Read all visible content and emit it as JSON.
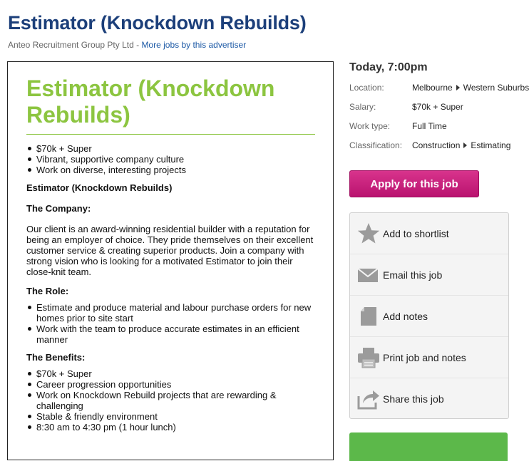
{
  "header": {
    "title": "Estimator (Knockdown Rebuilds)",
    "company": "Anteo Recruitment Group Pty Ltd",
    "separator": " - ",
    "more_jobs_link": "More jobs by this advertiser"
  },
  "ad": {
    "title": "Estimator (Knockdown Rebuilds)",
    "highlights": [
      "$70k + Super",
      "Vibrant, supportive company culture",
      "Work on diverse, interesting projects"
    ],
    "subtitle": "Estimator (Knockdown Rebuilds)",
    "company_heading": "The Company:",
    "company_text": "Our client is an award-winning residential builder with a reputation for being an employer of choice. They pride themselves on their excellent customer service & creating superior products. Join a company with strong vision who is looking for a motivated Estimator to join their close-knit team.",
    "role_heading": "The Role:",
    "role_items": [
      "Estimate and produce material and labour purchase orders for new homes prior to site start",
      "Work with the team to produce accurate estimates in an efficient manner"
    ],
    "benefits_heading": "The Benefits:",
    "benefits_items": [
      "$70k + Super",
      "Career progression opportunities",
      "Work on Knockdown Rebuild projects that are rewarding & challenging",
      "Stable & friendly environment",
      "8:30 am to 4:30 pm (1 hour lunch)"
    ]
  },
  "sidebar": {
    "posted": "Today, 7:00pm",
    "location_label": "Location:",
    "location": [
      "Melbourne",
      "Western Suburbs"
    ],
    "salary_label": "Salary:",
    "salary": "$70k + Super",
    "work_type_label": "Work type:",
    "work_type": "Full Time",
    "classification_label": "Classification:",
    "classification": [
      "Construction",
      "Estimating"
    ],
    "apply_button": "Apply for this job",
    "tools": [
      {
        "label": "Add to shortlist",
        "icon": "star-icon"
      },
      {
        "label": "Email this job",
        "icon": "envelope-icon"
      },
      {
        "label": "Add notes",
        "icon": "note-icon"
      },
      {
        "label": "Print job and notes",
        "icon": "printer-icon"
      },
      {
        "label": "Share this job",
        "icon": "share-icon"
      }
    ]
  },
  "colors": {
    "title_blue": "#1c3f7a",
    "ad_green": "#8cc540",
    "apply_pink": "#c91f7d",
    "link_blue": "#1d5aa6"
  }
}
